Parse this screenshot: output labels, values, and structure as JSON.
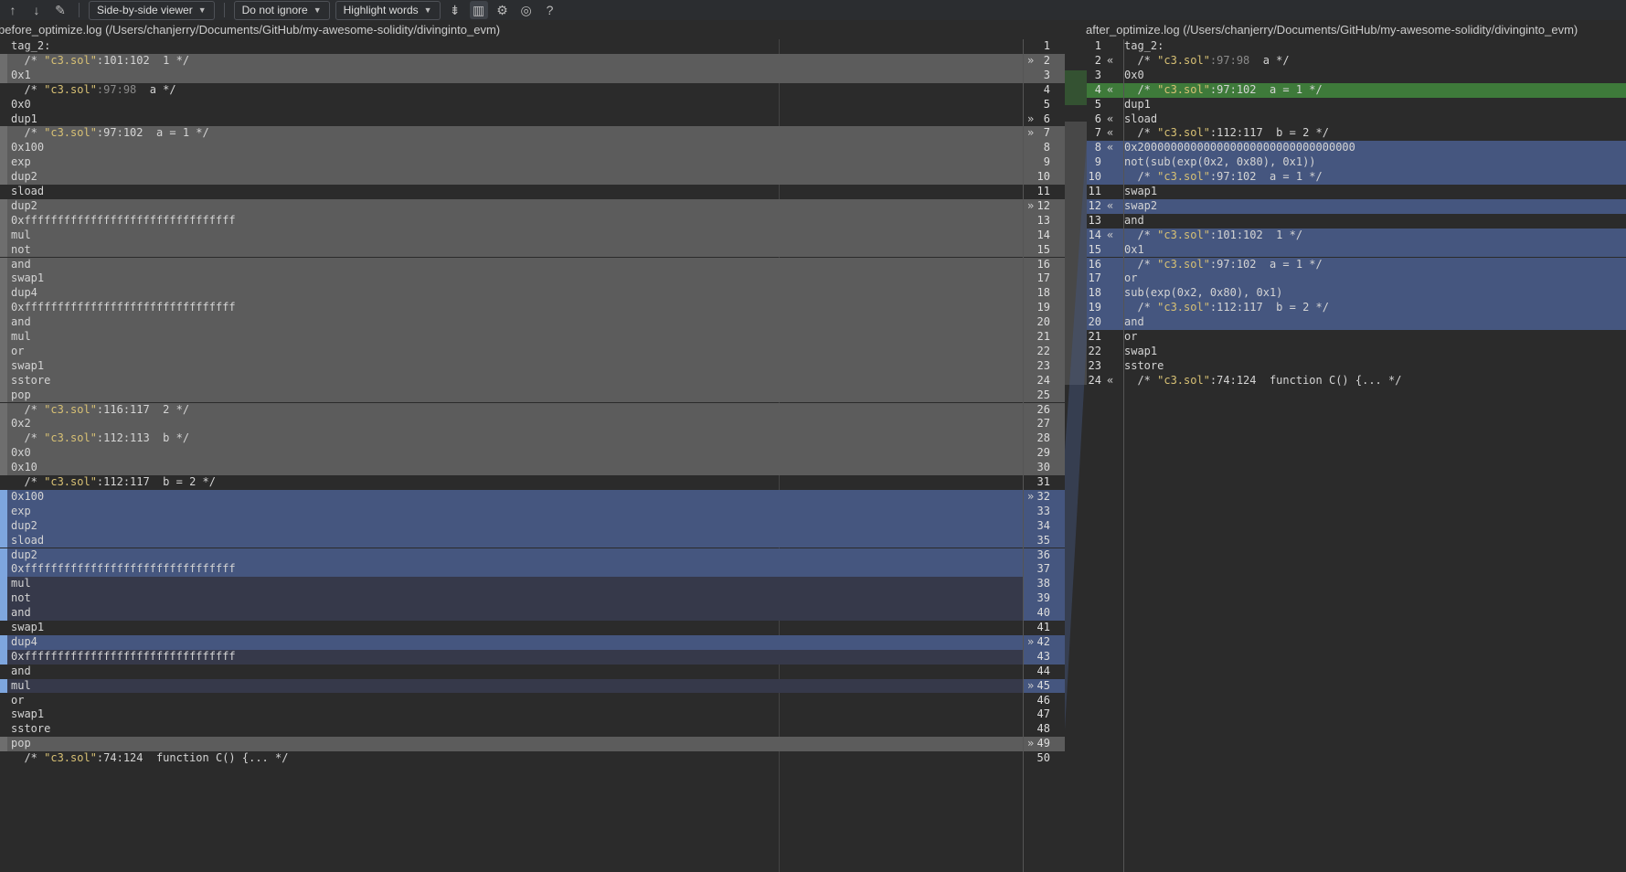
{
  "toolbar": {
    "viewer": "Side-by-side viewer",
    "ignore": "Do not ignore",
    "highlight": "Highlight words"
  },
  "titles": {
    "left": "before_optimize.log (/Users/chanjerry/Documents/GitHub/my-awesome-solidity/divinginto_evm)",
    "right": "after_optimize.log (/Users/chanjerry/Documents/GitHub/my-awesome-solidity/divinginto_evm)"
  },
  "left_lines": [
    {
      "n": "1",
      "text": "tag_2:",
      "bg": "",
      "arrow": ""
    },
    {
      "n": "2",
      "pre": "  /* ",
      "str": "\"c3.sol\"",
      "post": ":101:102  1 */",
      "bg": "mod",
      "arrow": "»"
    },
    {
      "n": "3",
      "text": "0x1",
      "bg": "mod",
      "arrow": ""
    },
    {
      "n": "4",
      "pre": "  /* ",
      "str": "\"c3.sol\"",
      "faded": ":97:98",
      "post": "  a */",
      "bg": "",
      "arrow": ""
    },
    {
      "n": "5",
      "text": "0x0",
      "bg": "",
      "arrow": ""
    },
    {
      "n": "6",
      "text": "dup1",
      "bg": "",
      "arrow": "»"
    },
    {
      "n": "7",
      "pre": "  /* ",
      "str": "\"c3.sol\"",
      "post": ":97:102  a = 1 */",
      "bg": "mod",
      "arrow": "»"
    },
    {
      "n": "8",
      "text": "0x100",
      "bg": "mod",
      "arrow": ""
    },
    {
      "n": "9",
      "text": "exp",
      "bg": "mod",
      "arrow": ""
    },
    {
      "n": "10",
      "text": "dup2",
      "bg": "mod",
      "arrow": ""
    },
    {
      "n": "11",
      "text": "sload",
      "bg": "",
      "arrow": ""
    },
    {
      "n": "12",
      "text": "dup2",
      "bg": "mod",
      "arrow": "»"
    },
    {
      "n": "13",
      "text": "0xffffffffffffffffffffffffffffffff",
      "bg": "mod",
      "arrow": ""
    },
    {
      "n": "14",
      "text": "mul",
      "bg": "mod",
      "arrow": ""
    },
    {
      "n": "15",
      "text": "not",
      "bg": "mod",
      "arrow": ""
    },
    {
      "n": "16",
      "text": "and",
      "bg": "mod",
      "arrow": ""
    },
    {
      "n": "17",
      "text": "swap1",
      "bg": "mod",
      "arrow": ""
    },
    {
      "n": "18",
      "text": "dup4",
      "bg": "mod",
      "arrow": ""
    },
    {
      "n": "19",
      "text": "0xffffffffffffffffffffffffffffffff",
      "bg": "mod",
      "arrow": ""
    },
    {
      "n": "20",
      "text": "and",
      "bg": "mod",
      "arrow": ""
    },
    {
      "n": "21",
      "text": "mul",
      "bg": "mod",
      "arrow": ""
    },
    {
      "n": "22",
      "text": "or",
      "bg": "mod",
      "arrow": ""
    },
    {
      "n": "23",
      "text": "swap1",
      "bg": "mod",
      "arrow": ""
    },
    {
      "n": "24",
      "text": "sstore",
      "bg": "mod",
      "arrow": ""
    },
    {
      "n": "25",
      "text": "pop",
      "bg": "mod",
      "arrow": ""
    },
    {
      "n": "26",
      "pre": "  /* ",
      "str": "\"c3.sol\"",
      "post": ":116:117  2 */",
      "bg": "mod",
      "arrow": ""
    },
    {
      "n": "27",
      "text": "0x2",
      "bg": "mod",
      "arrow": ""
    },
    {
      "n": "28",
      "pre": "  /* ",
      "str": "\"c3.sol\"",
      "post": ":112:113  b */",
      "bg": "mod",
      "arrow": ""
    },
    {
      "n": "29",
      "text": "0x0",
      "bg": "mod",
      "arrow": ""
    },
    {
      "n": "30",
      "text": "0x10",
      "bg": "mod",
      "arrow": ""
    },
    {
      "n": "31",
      "pre": "  /* ",
      "str": "\"c3.sol\"",
      "post": ":112:117  b = 2 */",
      "bg": "",
      "arrow": ""
    },
    {
      "n": "32",
      "text": "0x100",
      "bg": "blue",
      "arrow": "»"
    },
    {
      "n": "33",
      "text": "exp",
      "bg": "blue",
      "arrow": ""
    },
    {
      "n": "34",
      "text": "dup2",
      "bg": "blue",
      "arrow": ""
    },
    {
      "n": "35",
      "text": "sload",
      "bg": "blue",
      "arrow": ""
    },
    {
      "n": "36",
      "text": "dup2",
      "bg": "blue",
      "arrow": ""
    },
    {
      "n": "37",
      "text": "0xffffffffffffffffffffffffffffffff",
      "bg": "blue",
      "arrow": ""
    },
    {
      "n": "38",
      "text": "mul",
      "bg": "bluedark",
      "arrow": ""
    },
    {
      "n": "39",
      "text": "not",
      "bg": "bluedark",
      "arrow": ""
    },
    {
      "n": "40",
      "text": "and",
      "bg": "bluedark",
      "arrow": ""
    },
    {
      "n": "41",
      "text": "swap1",
      "bg": "",
      "arrow": ""
    },
    {
      "n": "42",
      "text": "dup4",
      "bg": "blue",
      "arrow": "»"
    },
    {
      "n": "43",
      "text": "0xffffffffffffffffffffffffffffffff",
      "bg": "bluedark",
      "arrow": ""
    },
    {
      "n": "44",
      "text": "and",
      "bg": "",
      "arrow": ""
    },
    {
      "n": "45",
      "text": "mul",
      "bg": "bluedark",
      "arrow": "»"
    },
    {
      "n": "46",
      "text": "or",
      "bg": "",
      "arrow": ""
    },
    {
      "n": "47",
      "text": "swap1",
      "bg": "",
      "arrow": ""
    },
    {
      "n": "48",
      "text": "sstore",
      "bg": "",
      "arrow": ""
    },
    {
      "n": "49",
      "text": "pop",
      "bg": "mod",
      "arrow": "»"
    },
    {
      "n": "50",
      "pre": "  /* ",
      "str": "\"c3.sol\"",
      "post": ":74:124  function C() {... */",
      "bg": "",
      "arrow": ""
    }
  ],
  "right_lines": [
    {
      "n": "1",
      "text": "tag_2:",
      "bg": "",
      "arrow": ""
    },
    {
      "n": "2",
      "pre": "  /* ",
      "str": "\"c3.sol\"",
      "faded": ":97:98",
      "post": "  a */",
      "bg": "",
      "arrow": "«"
    },
    {
      "n": "3",
      "text": "0x0",
      "bg": "",
      "arrow": ""
    },
    {
      "n": "4",
      "pre": "  /* ",
      "str": "\"c3.sol\"",
      "post": ":97:102  a = 1 */",
      "bg": "green",
      "arrow": "«"
    },
    {
      "n": "5",
      "text": "dup1",
      "bg": "",
      "arrow": ""
    },
    {
      "n": "6",
      "text": "sload",
      "bg": "",
      "arrow": "«"
    },
    {
      "n": "7",
      "pre": "  /* ",
      "str": "\"c3.sol\"",
      "post": ":112:117  b = 2 */",
      "bg": "",
      "arrow": "«"
    },
    {
      "n": "8",
      "text": "0x200000000000000000000000000000000",
      "bg": "blue",
      "arrow": "«"
    },
    {
      "n": "9",
      "text": "not(sub(exp(0x2, 0x80), 0x1))",
      "bg": "blue",
      "arrow": ""
    },
    {
      "n": "10",
      "pre": "  /* ",
      "str": "\"c3.sol\"",
      "post": ":97:102  a = 1 */",
      "bg": "blue",
      "arrow": ""
    },
    {
      "n": "11",
      "text": "swap1",
      "bg": "",
      "arrow": ""
    },
    {
      "n": "12",
      "text": "swap2",
      "bg": "blue",
      "arrow": "«"
    },
    {
      "n": "13",
      "text": "and",
      "bg": "",
      "arrow": ""
    },
    {
      "n": "14",
      "pre": "  /* ",
      "str": "\"c3.sol\"",
      "post": ":101:102  1 */",
      "bg": "blue",
      "arrow": "«"
    },
    {
      "n": "15",
      "text": "0x1",
      "bg": "blue",
      "arrow": ""
    },
    {
      "n": "16",
      "pre": "  /* ",
      "str": "\"c3.sol\"",
      "post": ":97:102  a = 1 */",
      "bg": "blue",
      "arrow": ""
    },
    {
      "n": "17",
      "text": "or",
      "bg": "blue",
      "arrow": ""
    },
    {
      "n": "18",
      "text": "sub(exp(0x2, 0x80), 0x1)",
      "bg": "blue",
      "arrow": ""
    },
    {
      "n": "19",
      "pre": "  /* ",
      "str": "\"c3.sol\"",
      "post": ":112:117  b = 2 */",
      "bg": "blue",
      "arrow": ""
    },
    {
      "n": "20",
      "text": "and",
      "bg": "blue",
      "arrow": ""
    },
    {
      "n": "21",
      "text": "or",
      "bg": "",
      "arrow": ""
    },
    {
      "n": "22",
      "text": "swap1",
      "bg": "",
      "arrow": ""
    },
    {
      "n": "23",
      "text": "sstore",
      "bg": "",
      "arrow": ""
    },
    {
      "n": "24",
      "pre": "  /* ",
      "str": "\"c3.sol\"",
      "post": ":74:124  function C() {... */",
      "bg": "",
      "arrow": "«"
    }
  ],
  "colors": {
    "modified": "#5c5c5c",
    "changed": "#45567f",
    "inserted": "#3e7a3a",
    "string": "#d7c074"
  }
}
